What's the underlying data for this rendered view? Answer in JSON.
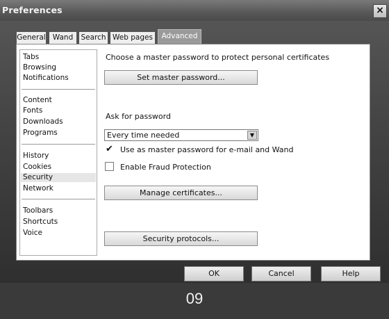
{
  "window": {
    "title": "Preferences",
    "close_glyph": "×"
  },
  "tabs": [
    {
      "label": "General",
      "active": false
    },
    {
      "label": "Wand",
      "active": false
    },
    {
      "label": "Search",
      "active": false
    },
    {
      "label": "Web pages",
      "active": false
    },
    {
      "label": "Advanced",
      "active": true
    }
  ],
  "sidebar": {
    "groups": [
      [
        "Tabs",
        "Browsing",
        "Notifications"
      ],
      [
        "Content",
        "Fonts",
        "Downloads",
        "Programs"
      ],
      [
        "History",
        "Cookies",
        "Security",
        "Network"
      ],
      [
        "Toolbars",
        "Shortcuts",
        "Voice"
      ]
    ],
    "selected": "Security"
  },
  "security": {
    "master_password_text": "Choose a master password to protect personal certificates",
    "set_master_password_label": "Set master password...",
    "ask_for_password_label": "Ask for password",
    "ask_for_password_value": "Every time needed",
    "use_master_for_mail_label": "Use as master password for e-mail and Wand",
    "use_master_for_mail_checked": true,
    "enable_fraud_label": "Enable Fraud Protection",
    "enable_fraud_checked": false,
    "manage_certificates_label": "Manage certificates...",
    "security_protocols_label": "Security protocols..."
  },
  "buttons": {
    "ok": "OK",
    "cancel": "Cancel",
    "help": "Help"
  },
  "footer": {
    "page_number": "09"
  },
  "icons": {
    "close": "close-icon",
    "dropdown": "chevron-down-icon",
    "check": "checkmark-icon"
  }
}
